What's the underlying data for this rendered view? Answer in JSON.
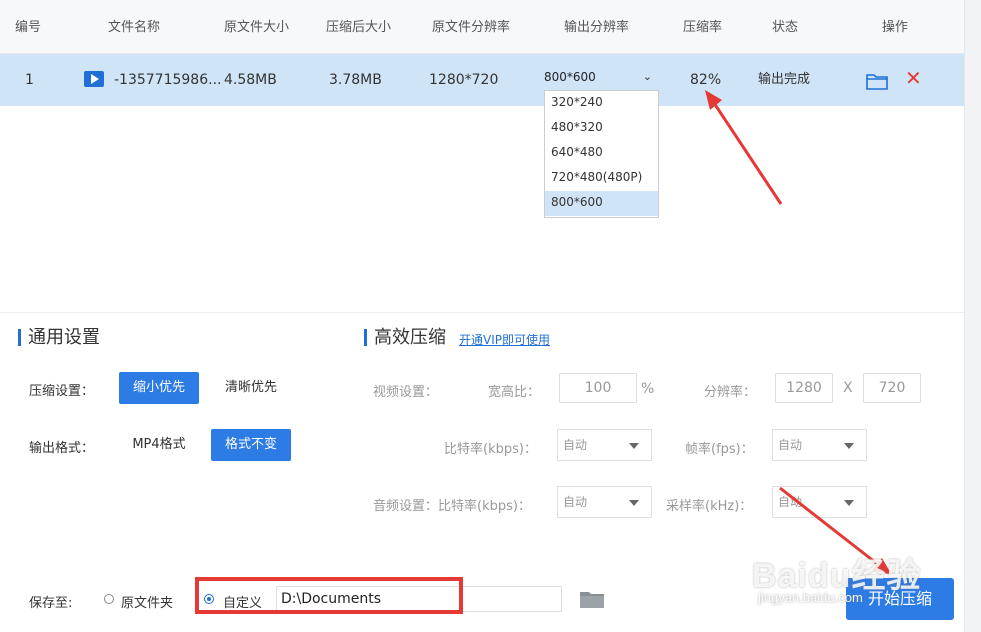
{
  "table": {
    "headers": [
      "编号",
      "文件名称",
      "原文件大小",
      "压缩后大小",
      "原文件分辨率",
      "输出分辨率",
      "压缩率",
      "状态",
      "操作"
    ],
    "row": {
      "index": "1",
      "file_name": "-1357715986...",
      "original_size": "4.58MB",
      "compressed_size": "3.78MB",
      "original_resolution": "1280*720",
      "output_resolution": "800*600",
      "ratio": "82%",
      "status": "输出完成"
    },
    "resolution_options": [
      "320*240",
      "480*320",
      "640*480",
      "720*480(480P)",
      "800*600"
    ],
    "selected_option": "800*600"
  },
  "general": {
    "title": "通用设置",
    "compress_label": "压缩设置：",
    "compress_options": [
      "缩小优先",
      "清晰优先"
    ],
    "compress_selected": "缩小优先",
    "format_label": "输出格式：",
    "format_options": [
      "MP4格式",
      "格式不变"
    ],
    "format_selected": "格式不变"
  },
  "advanced": {
    "title": "高效压缩",
    "vip_link": "开通VIP即可使用",
    "video_label": "视频设置：",
    "aspect_label": "宽高比：",
    "aspect_value": "100",
    "aspect_unit": "%",
    "resolution_label": "分辨率：",
    "width_value": "1280",
    "times": "X",
    "height_value": "720",
    "bitrate_label": "比特率(kbps)：",
    "bitrate_value": "自动",
    "fps_label": "帧率(fps)：",
    "fps_value": "自动",
    "audio_label": "音频设置：比特率(kbps)：",
    "audio_bitrate_value": "自动",
    "sample_label": "采样率(kHz)：",
    "sample_value": "自动"
  },
  "save": {
    "label": "保存至:",
    "option_original": "原文件夹",
    "option_custom": "自定义",
    "path": "D:\\Documents",
    "selected": "自定义"
  },
  "start_button": "开始压缩",
  "watermark": {
    "main": "Baidu经验",
    "sub": "jingyan.baidu.com"
  },
  "colors": {
    "accent": "#2d7be5",
    "row_highlight": "#cfe4f7",
    "annotation": "#e53935"
  }
}
